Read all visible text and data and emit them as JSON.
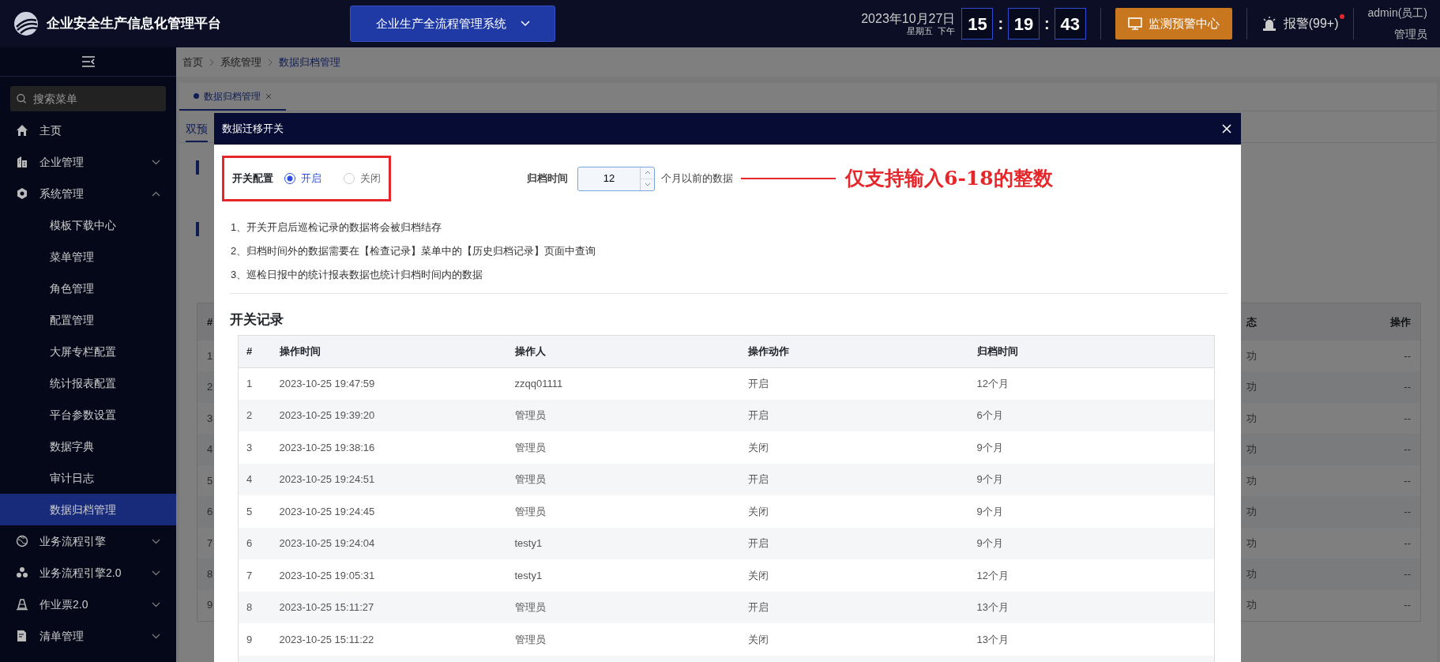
{
  "header": {
    "title": "企业安全生产信息化管理平台",
    "system_selector": "企业生产全流程管理系统",
    "date": "2023年10月27日",
    "weekday": "星期五",
    "period": "下午",
    "clock": [
      "15",
      "19",
      "43"
    ],
    "clock_separators": [
      ":",
      ":"
    ],
    "monitor_button": "监测预警中心",
    "alarm": {
      "label": "报警(99+)",
      "unread": true
    },
    "user": {
      "name": "admin(员工)",
      "role": "管理员"
    }
  },
  "sidebar": {
    "search": {
      "placeholder": "搜索菜单"
    },
    "items": [
      {
        "label": "主页",
        "selected": false
      },
      {
        "label": "企业管理",
        "expanded": false,
        "selected": false
      },
      {
        "label": "系统管理",
        "expanded": true,
        "selected": false,
        "children": [
          {
            "label": "模板下载中心",
            "selected": false
          },
          {
            "label": "菜单管理",
            "selected": false
          },
          {
            "label": "角色管理",
            "selected": false
          },
          {
            "label": "配置管理",
            "selected": false
          },
          {
            "label": "大屏专栏配置",
            "selected": false
          },
          {
            "label": "统计报表配置",
            "selected": false
          },
          {
            "label": "平台参数设置",
            "selected": false
          },
          {
            "label": "数据字典",
            "selected": false
          },
          {
            "label": "审计日志",
            "selected": false
          },
          {
            "label": "数据归档管理",
            "selected": true
          }
        ]
      },
      {
        "label": "业务流程引擎",
        "expanded": false,
        "selected": false
      },
      {
        "label": "业务流程引擎2.0",
        "expanded": false,
        "selected": false
      },
      {
        "label": "作业票2.0",
        "expanded": false,
        "selected": false
      },
      {
        "label": "清单管理",
        "expanded": false,
        "selected": false
      }
    ]
  },
  "breadcrumbs": [
    "首页",
    "系统管理",
    "数据归档管理"
  ],
  "page_tabs": [
    {
      "label": "数据归档管理",
      "selected": true
    }
  ],
  "sub_tabs": [
    {
      "label": "双预",
      "selected": true
    }
  ],
  "background_table": {
    "columns": [
      "#",
      "态",
      "操作"
    ],
    "rows": [
      {
        "index": "1",
        "status": "功",
        "action": "--"
      },
      {
        "index": "2",
        "status": "功",
        "action": "--"
      },
      {
        "index": "3",
        "status": "功",
        "action": "--"
      },
      {
        "index": "4",
        "status": "功",
        "action": "--"
      },
      {
        "index": "5",
        "status": "功",
        "action": "--"
      },
      {
        "index": "6",
        "status": "功",
        "action": "--"
      },
      {
        "index": "7",
        "status": "功",
        "action": "--"
      },
      {
        "index": "8",
        "status": "功",
        "action": "--"
      },
      {
        "index": "9",
        "status": "功",
        "action": "--"
      }
    ]
  },
  "dialog": {
    "title": "数据迁移开关",
    "switch": {
      "label": "开关配置",
      "options": [
        {
          "label": "开启",
          "selected": true
        },
        {
          "label": "关闭",
          "selected": false
        }
      ]
    },
    "archive": {
      "label": "归档时间",
      "value": "12",
      "suffix": "个月以前的数据"
    },
    "annotation": "仅支持输入6-18的整数",
    "notes": [
      "1、开关开启后巡检记录的数据将会被归档结存",
      "2、归档时间外的数据需要在【检查记录】菜单中的【历史归档记录】页面中查询",
      "3、巡检日报中的统计报表数据也统计归档时间内的数据"
    ],
    "records": {
      "title": "开关记录",
      "columns": [
        "#",
        "操作时间",
        "操作人",
        "操作动作",
        "归档时间"
      ],
      "rows": [
        [
          "1",
          "2023-10-25 19:47:59",
          "zzqq01111",
          "开启",
          "12个月"
        ],
        [
          "2",
          "2023-10-25 19:39:20",
          "管理员",
          "开启",
          "6个月"
        ],
        [
          "3",
          "2023-10-25 19:38:16",
          "管理员",
          "关闭",
          "9个月"
        ],
        [
          "4",
          "2023-10-25 19:24:51",
          "管理员",
          "开启",
          "9个月"
        ],
        [
          "5",
          "2023-10-25 19:24:45",
          "管理员",
          "关闭",
          "9个月"
        ],
        [
          "6",
          "2023-10-25 19:24:04",
          "testy1",
          "开启",
          "9个月"
        ],
        [
          "7",
          "2023-10-25 19:05:31",
          "testy1",
          "关闭",
          "12个月"
        ],
        [
          "8",
          "2023-10-25 15:11:27",
          "管理员",
          "开启",
          "13个月"
        ],
        [
          "9",
          "2023-10-25 15:11:22",
          "管理员",
          "关闭",
          "13个月"
        ]
      ]
    }
  }
}
